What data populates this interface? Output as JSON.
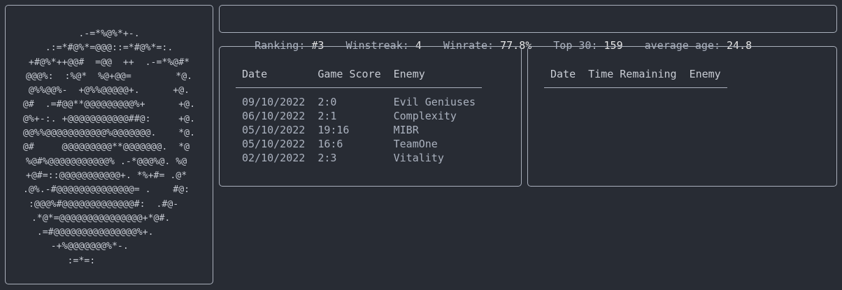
{
  "logo": {
    "ascii": "      .-=*%@%*+-.      \n   .:=*#@%*=@@@::=*#@%*=:.   \n+#@%*++@@#  =@@  ++  .-=*%@#*\n@@@%:  :%@*  %@+@@=        *@.\n@%%@@%-  +@%%@@@@@+.      +@.\n@#  .=#@@**@@@@@@@@@%+      +@.\n@%+-:. +@@@@@@@@@@@##@:     +@.\n@@%%@@@@@@@@@@@%@@@@@@@.    *@.\n@#     @@@@@@@@@**@@@@@@@.  *@ \n%@#%@@@@@@@@@@@% .-*@@@%@. %@ \n+@#=::@@@@@@@@@@@+. *%+#= .@* \n.@%.-#@@@@@@@@@@@@@@= .    #@: \n:@@@%#@@@@@@@@@@@@@#:  .#@-  \n.*@*=@@@@@@@@@@@@@@@+*@#.   \n.=#@@@@@@@@@@@@@@@%+.     \n-+%@@@@@@@%*-.       \n:=*=:          "
  },
  "stats": [
    {
      "label": "Ranking:",
      "value": "#3"
    },
    {
      "label": "Winstreak:",
      "value": "4"
    },
    {
      "label": "Winrate:",
      "value": "77.8%"
    },
    {
      "label": "Top 30:",
      "value": "159"
    },
    {
      "label": "average age:",
      "value": "24.8"
    }
  ],
  "results": {
    "headers": {
      "date": "Date",
      "score": "Game Score",
      "enemy": "Enemy"
    },
    "rows": [
      {
        "date": "09/10/2022",
        "score": "2:0",
        "enemy": "Evil Geniuses",
        "outcome": "win"
      },
      {
        "date": "06/10/2022",
        "score": "2:1",
        "enemy": "Complexity",
        "outcome": "win"
      },
      {
        "date": "05/10/2022",
        "score": "19:16",
        "enemy": "MIBR",
        "outcome": "win"
      },
      {
        "date": "05/10/2022",
        "score": "16:6",
        "enemy": "TeamOne",
        "outcome": "win"
      },
      {
        "date": "02/10/2022",
        "score": "2:3",
        "enemy": "Vitality",
        "outcome": "loss"
      }
    ]
  },
  "upcoming": {
    "headers": {
      "date": "Date",
      "time": "Time Remaining",
      "enemy": "Enemy"
    },
    "rows": []
  },
  "colors": {
    "background": "#282c34",
    "border": "#aab0bc",
    "win": "#98c379",
    "loss": "#e06c75"
  }
}
